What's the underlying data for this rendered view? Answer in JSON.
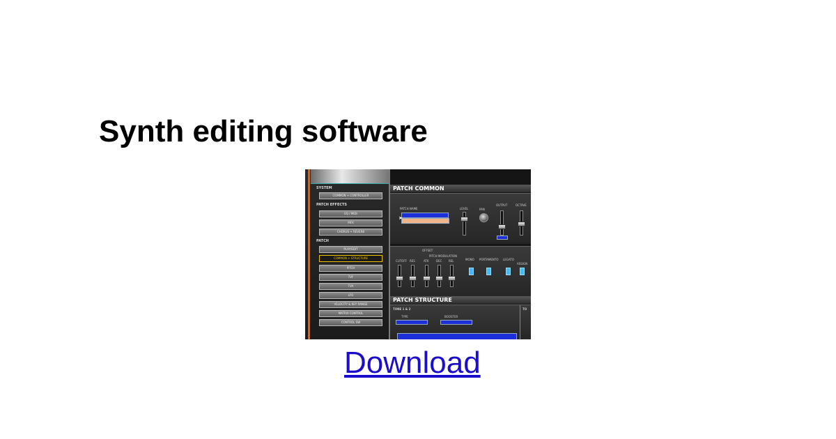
{
  "page": {
    "title": "Synth editing software",
    "download_label": "Download"
  },
  "screenshot": {
    "left_panel": {
      "section_system": "SYSTEM",
      "section_patch_effects": "PATCH EFFECTS",
      "section_patch": "PATCH",
      "buttons_system": [
        "COMMON + CONTROLLER"
      ],
      "buttons_effects": [
        "EQ / MIDI",
        "MFX",
        "CHORUS + REVERB"
      ],
      "buttons_patch": [
        "PLAY/EDIT",
        "COMMON + STRUCTURE",
        "PITCH",
        "TVF",
        "TVA",
        "LFO",
        "VELOCITY & KEY RANGE",
        "MATRIX CONTROL",
        "CONTROL SW"
      ],
      "selected_patch_button": "COMMON + STRUCTURE"
    },
    "patch_common": {
      "header": "PATCH COMMON",
      "patch_name_label": "PATCH NAME",
      "level_label": "LEVEL",
      "pan_label": "PAN",
      "output_label": "OUTPUT",
      "octave_label": "OCTAVE",
      "offset_label": "OFFSET",
      "pitch_mod_label": "PITCH MODULATION",
      "fader_labels": [
        "CUTOFF",
        "RES",
        "ATK",
        "DEC",
        "REL"
      ],
      "switch_labels": [
        "MONO",
        "PORTAMENTO",
        "LEGATO",
        "ASSIGN"
      ]
    },
    "patch_structure": {
      "header": "PATCH STRUCTURE",
      "tone_label": "TONE 1 & 2",
      "tone_label_right": "TO",
      "type_label": "TYPE",
      "booster_label": "BOOSTER"
    },
    "colors": {
      "selected_outline": "#f0c000",
      "display_blue": "#1c2fd8",
      "led_blue": "#46b8ff",
      "left_edge": "#b86a3a"
    }
  }
}
